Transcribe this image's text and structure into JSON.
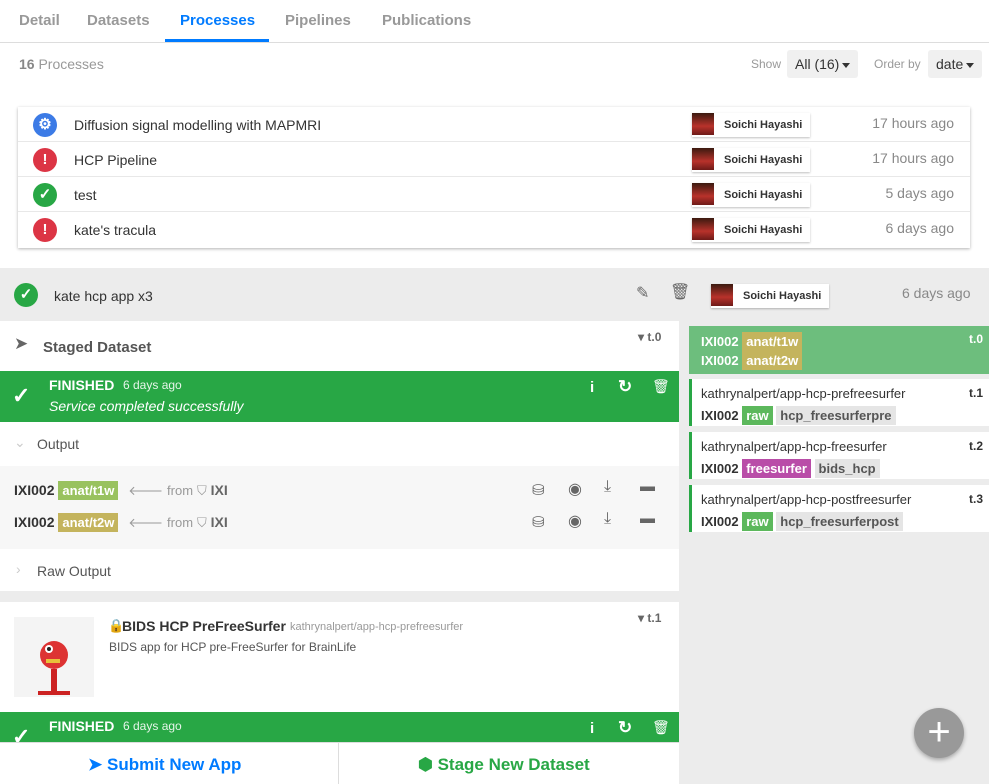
{
  "tabs": [
    "Detail",
    "Datasets",
    "Processes",
    "Pipelines",
    "Publications"
  ],
  "header": {
    "count": "16",
    "count_label": "Processes",
    "show_label": "Show",
    "show_value": "All (16)",
    "order_label": "Order by",
    "order_value": "date"
  },
  "processes": [
    {
      "name": "Diffusion signal modelling with MAPMRI",
      "user": "Soichi Hayashi",
      "time": "17 hours ago",
      "status": "running"
    },
    {
      "name": "HCP Pipeline",
      "user": "Soichi Hayashi",
      "time": "17 hours ago",
      "status": "failed"
    },
    {
      "name": "test",
      "user": "Soichi Hayashi",
      "time": "5 days ago",
      "status": "finished"
    },
    {
      "name": "kate's tracula",
      "user": "Soichi Hayashi",
      "time": "6 days ago",
      "status": "failed"
    }
  ],
  "selected": {
    "name": "kate hcp app x3",
    "user": "Soichi Hayashi",
    "time": "6 days ago"
  },
  "staged": {
    "title": "Staged Dataset",
    "tid": "t.0",
    "status": "FINISHED",
    "status_time": "6 days ago",
    "status_msg": "Service completed successfully",
    "output_label": "Output",
    "raw_output_label": "Raw Output",
    "outputs": [
      {
        "subject": "IXI002",
        "datatype": "anat/t1w",
        "from": "from",
        "project": "IXI"
      },
      {
        "subject": "IXI002",
        "datatype": "anat/t2w",
        "from": "from",
        "project": "IXI"
      }
    ]
  },
  "app": {
    "tid": "t.1",
    "name": "BIDS HCP PreFreeSurfer",
    "repo": "kathrynalpert/app-hcp-prefreesurfer",
    "desc": "BIDS app for HCP pre-FreeSurfer for BrainLife",
    "status": "FINISHED",
    "status_time": "6 days ago"
  },
  "pipeline": [
    {
      "t": "t.0",
      "lines": [
        [
          "IXI002",
          "anat/t1w"
        ],
        [
          "IXI002",
          "anat/t2w"
        ]
      ]
    },
    {
      "t": "t.1",
      "name": "kathrynalpert/app-hcp-prefreesurfer",
      "subject": "IXI002",
      "tag": "raw",
      "extra": "hcp_freesurferpre"
    },
    {
      "t": "t.2",
      "name": "kathrynalpert/app-hcp-freesurfer",
      "subject": "IXI002",
      "tag": "freesurfer",
      "extra": "bids_hcp"
    },
    {
      "t": "t.3",
      "name": "kathrynalpert/app-hcp-postfreesurfer",
      "subject": "IXI002",
      "tag": "raw",
      "extra": "hcp_freesurferpost"
    }
  ],
  "bottom": {
    "submit_label": "Submit New App",
    "stage_label": "Stage New Dataset"
  },
  "colors": {
    "accent": "#007bff",
    "success": "#28a745",
    "danger": "#dc3545",
    "running": "#3c7be6"
  }
}
